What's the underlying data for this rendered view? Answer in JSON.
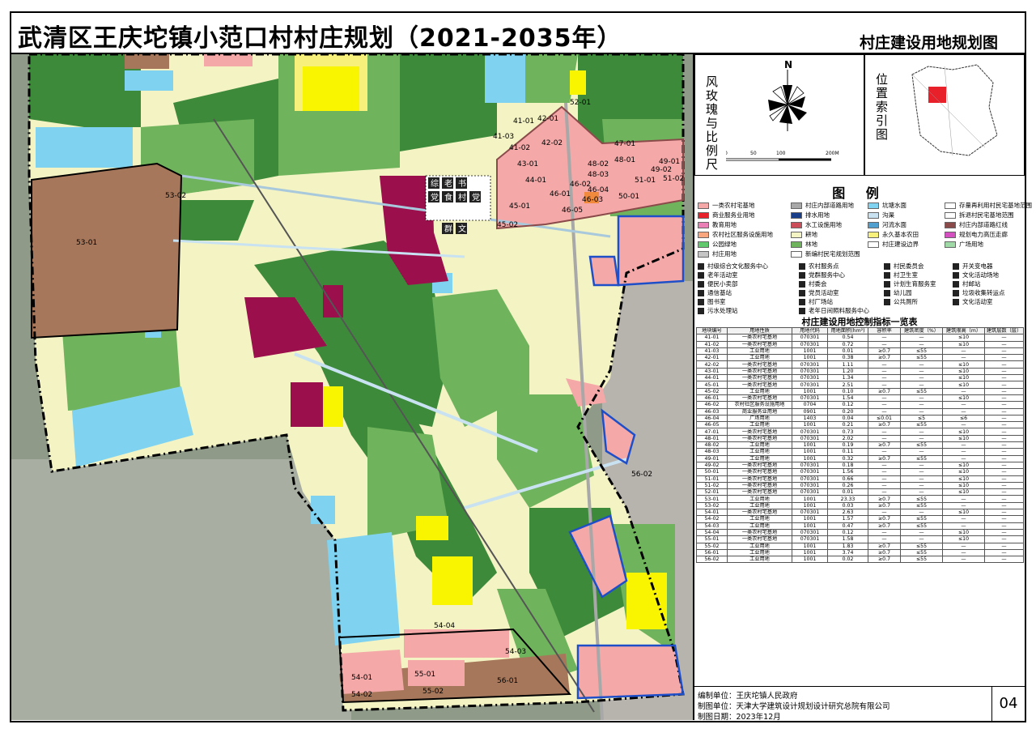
{
  "title": "武清区王庆坨镇小范口村村庄规划（2021-2035年）",
  "subtitle": "村庄建设用地规划图",
  "compass": {
    "north": "N",
    "title": "风玫瑰与比例尺",
    "scale_labels": [
      "0",
      "50",
      "100",
      "200M"
    ]
  },
  "index_map": {
    "title": "位置索引图"
  },
  "legend": {
    "title": "图  例",
    "items": [
      {
        "label": "一类农村宅基地",
        "color": "#f4a9a8"
      },
      {
        "label": "村庄内部道路用地",
        "color": "#a8a8a8"
      },
      {
        "label": "坑塘水面",
        "color": "#7fd3f0"
      },
      {
        "label": "存量再利用村民宅基地范围",
        "color": "#ffffff"
      },
      {
        "label": "商业服务业用地",
        "color": "#e8202a"
      },
      {
        "label": "排水用地",
        "color": "#1a3f8a"
      },
      {
        "label": "沟渠",
        "color": "#c9e2f2"
      },
      {
        "label": "拆退村民宅基地范围",
        "color": "#ffffff"
      },
      {
        "label": "教育用地",
        "color": "#e97fb4"
      },
      {
        "label": "水工设施用地",
        "color": "#cc4d5a"
      },
      {
        "label": "河流水面",
        "color": "#4f9fcf"
      },
      {
        "label": "村庄内部道路红线",
        "color": "#8b4a4a"
      },
      {
        "label": "农村社区服务设施用地",
        "color": "#f9a57e"
      },
      {
        "label": "耕地",
        "color": "#f3f3c4"
      },
      {
        "label": "永久基本农田",
        "color": "#f7f07a"
      },
      {
        "label": "规划电力高压走廊",
        "color": "#d44fbf"
      },
      {
        "label": "公园绿地",
        "color": "#5fc96b"
      },
      {
        "label": "林地",
        "color": "#6fb35c"
      },
      {
        "label": "村庄建设边界",
        "color": "#ffffff"
      },
      {
        "label": "广场用地",
        "color": "#9ed9a6"
      },
      {
        "label": "村庄用地",
        "color": "#c5c5c5"
      },
      {
        "label": "新编村民宅规划范围",
        "color": "#ffffff"
      }
    ],
    "icons": [
      "村级综合文化服务中心",
      "农村服务点",
      "村民委员会",
      "开关变电器",
      "老年活动室",
      "党群服务中心",
      "村卫生室",
      "文化活动场地",
      "便民小卖部",
      "村委会",
      "计划生育服务室",
      "村邮站",
      "通信基站",
      "党员活动室",
      "幼儿园",
      "垃圾收集转运点",
      "图书室",
      "村厂场站",
      "公共厕所",
      "文化活动室",
      "污水处理站",
      "老年日间照料服务中心"
    ]
  },
  "table": {
    "title": "村庄建设用地控制指标一览表",
    "headers": [
      "地块编号",
      "用地性质",
      "用地代码",
      "用地面积(hm²)",
      "容积率",
      "建筑密度（%）",
      "建筑限高（m）",
      "建筑层数（层）"
    ],
    "rows": [
      [
        "41-01",
        "一类农村宅基地",
        "070301",
        "0.54",
        "—",
        "—",
        "≤10",
        "—"
      ],
      [
        "41-02",
        "一类农村宅基地",
        "070301",
        "0.72",
        "—",
        "—",
        "≤10",
        "—"
      ],
      [
        "41-03",
        "工业用地",
        "1001",
        "0.01",
        "≥0.7",
        "≤55",
        "—",
        "—"
      ],
      [
        "42-01",
        "工业用地",
        "1001",
        "0.38",
        "≥0.7",
        "≤55",
        "—",
        "—"
      ],
      [
        "42-02",
        "一类农村宅基地",
        "070301",
        "1.11",
        "—",
        "—",
        "≤10",
        "—"
      ],
      [
        "43-01",
        "一类农村宅基地",
        "070301",
        "1.20",
        "—",
        "—",
        "≤10",
        "—"
      ],
      [
        "44-01",
        "一类农村宅基地",
        "070301",
        "1.34",
        "—",
        "—",
        "≤10",
        "—"
      ],
      [
        "45-01",
        "一类农村宅基地",
        "070301",
        "2.51",
        "—",
        "—",
        "≤10",
        "—"
      ],
      [
        "45-02",
        "工业用地",
        "1001",
        "0.10",
        "≥0.7",
        "≤55",
        "—",
        "—"
      ],
      [
        "46-01",
        "一类农村宅基地",
        "070301",
        "1.54",
        "—",
        "—",
        "≤10",
        "—"
      ],
      [
        "46-02",
        "农村社区服务设施用地",
        "0704",
        "0.12",
        "—",
        "—",
        "—",
        "—"
      ],
      [
        "46-03",
        "商业服务业用地",
        "0901",
        "0.20",
        "—",
        "—",
        "—",
        "—"
      ],
      [
        "46-04",
        "广场用地",
        "1403",
        "0.04",
        "≤0.01",
        "≤5",
        "≤6",
        "—"
      ],
      [
        "46-05",
        "工业用地",
        "1001",
        "0.21",
        "≥0.7",
        "≤55",
        "—",
        "—"
      ],
      [
        "47-01",
        "一类农村宅基地",
        "070301",
        "0.73",
        "—",
        "—",
        "≤10",
        "—"
      ],
      [
        "48-01",
        "一类农村宅基地",
        "070301",
        "2.02",
        "—",
        "—",
        "≤10",
        "—"
      ],
      [
        "48-02",
        "工业用地",
        "1001",
        "0.19",
        "≥0.7",
        "≤55",
        "—",
        "—"
      ],
      [
        "48-03",
        "工业用地",
        "1001",
        "0.11",
        "—",
        "—",
        "—",
        "—"
      ],
      [
        "49-01",
        "工业用地",
        "1001",
        "0.32",
        "≥0.7",
        "≤55",
        "—",
        "—"
      ],
      [
        "49-02",
        "一类农村宅基地",
        "070301",
        "0.18",
        "—",
        "—",
        "≤10",
        "—"
      ],
      [
        "50-01",
        "一类农村宅基地",
        "070301",
        "1.56",
        "—",
        "—",
        "≤10",
        "—"
      ],
      [
        "51-01",
        "一类农村宅基地",
        "070301",
        "0.66",
        "—",
        "—",
        "≤10",
        "—"
      ],
      [
        "51-02",
        "一类农村宅基地",
        "070301",
        "0.26",
        "—",
        "—",
        "≤10",
        "—"
      ],
      [
        "52-01",
        "一类农村宅基地",
        "070301",
        "0.01",
        "—",
        "—",
        "≤10",
        "—"
      ],
      [
        "53-01",
        "工业用地",
        "1001",
        "23.33",
        "≥0.7",
        "≤55",
        "—",
        "—"
      ],
      [
        "53-02",
        "工业用地",
        "1001",
        "0.03",
        "≥0.7",
        "≤55",
        "—",
        "—"
      ],
      [
        "54-01",
        "一类农村宅基地",
        "070301",
        "2.63",
        "—",
        "—",
        "≤10",
        "—"
      ],
      [
        "54-02",
        "工业用地",
        "1001",
        "1.57",
        "≥0.7",
        "≤55",
        "—",
        "—"
      ],
      [
        "54-03",
        "工业用地",
        "1001",
        "0.47",
        "≥0.7",
        "≤55",
        "—",
        "—"
      ],
      [
        "54-04",
        "一类农村宅基地",
        "070301",
        "0.12",
        "—",
        "—",
        "≤10",
        "—"
      ],
      [
        "55-01",
        "一类农村宅基地",
        "070301",
        "1.58",
        "—",
        "—",
        "≤10",
        "—"
      ],
      [
        "55-02",
        "工业用地",
        "1001",
        "1.83",
        "≥0.7",
        "≤55",
        "—",
        "—"
      ],
      [
        "56-01",
        "工业用地",
        "1001",
        "3.74",
        "≥0.7",
        "≤55",
        "—",
        "—"
      ],
      [
        "56-02",
        "工业用地",
        "1001",
        "0.02",
        "≥0.7",
        "≤55",
        "—",
        "—"
      ]
    ]
  },
  "footer": {
    "line1": "编制单位：王庆坨镇人民政府",
    "line2": "制图单位：天津大学建筑设计规划设计研究总院有限公司",
    "line3": "制图日期：2023年12月",
    "page": "04"
  },
  "map": {
    "facility_icons": [
      "综",
      "老",
      "书",
      "党",
      "食",
      "村",
      "党",
      "群",
      "文"
    ],
    "parcels": [
      "41-03",
      "42-01",
      "41-01",
      "41-02",
      "42-02",
      "43-01",
      "44-01",
      "45-01",
      "45-02",
      "46-01",
      "46-02",
      "46-03",
      "46-04",
      "46-05",
      "47-01",
      "48-01",
      "48-02",
      "48-03",
      "49-01",
      "49-02",
      "50-01",
      "51-01",
      "51-02",
      "52-01",
      "53-01",
      "53-02",
      "54-01",
      "54-02",
      "54-03",
      "54-04",
      "55-01",
      "55-02",
      "56-01",
      "56-02"
    ]
  }
}
